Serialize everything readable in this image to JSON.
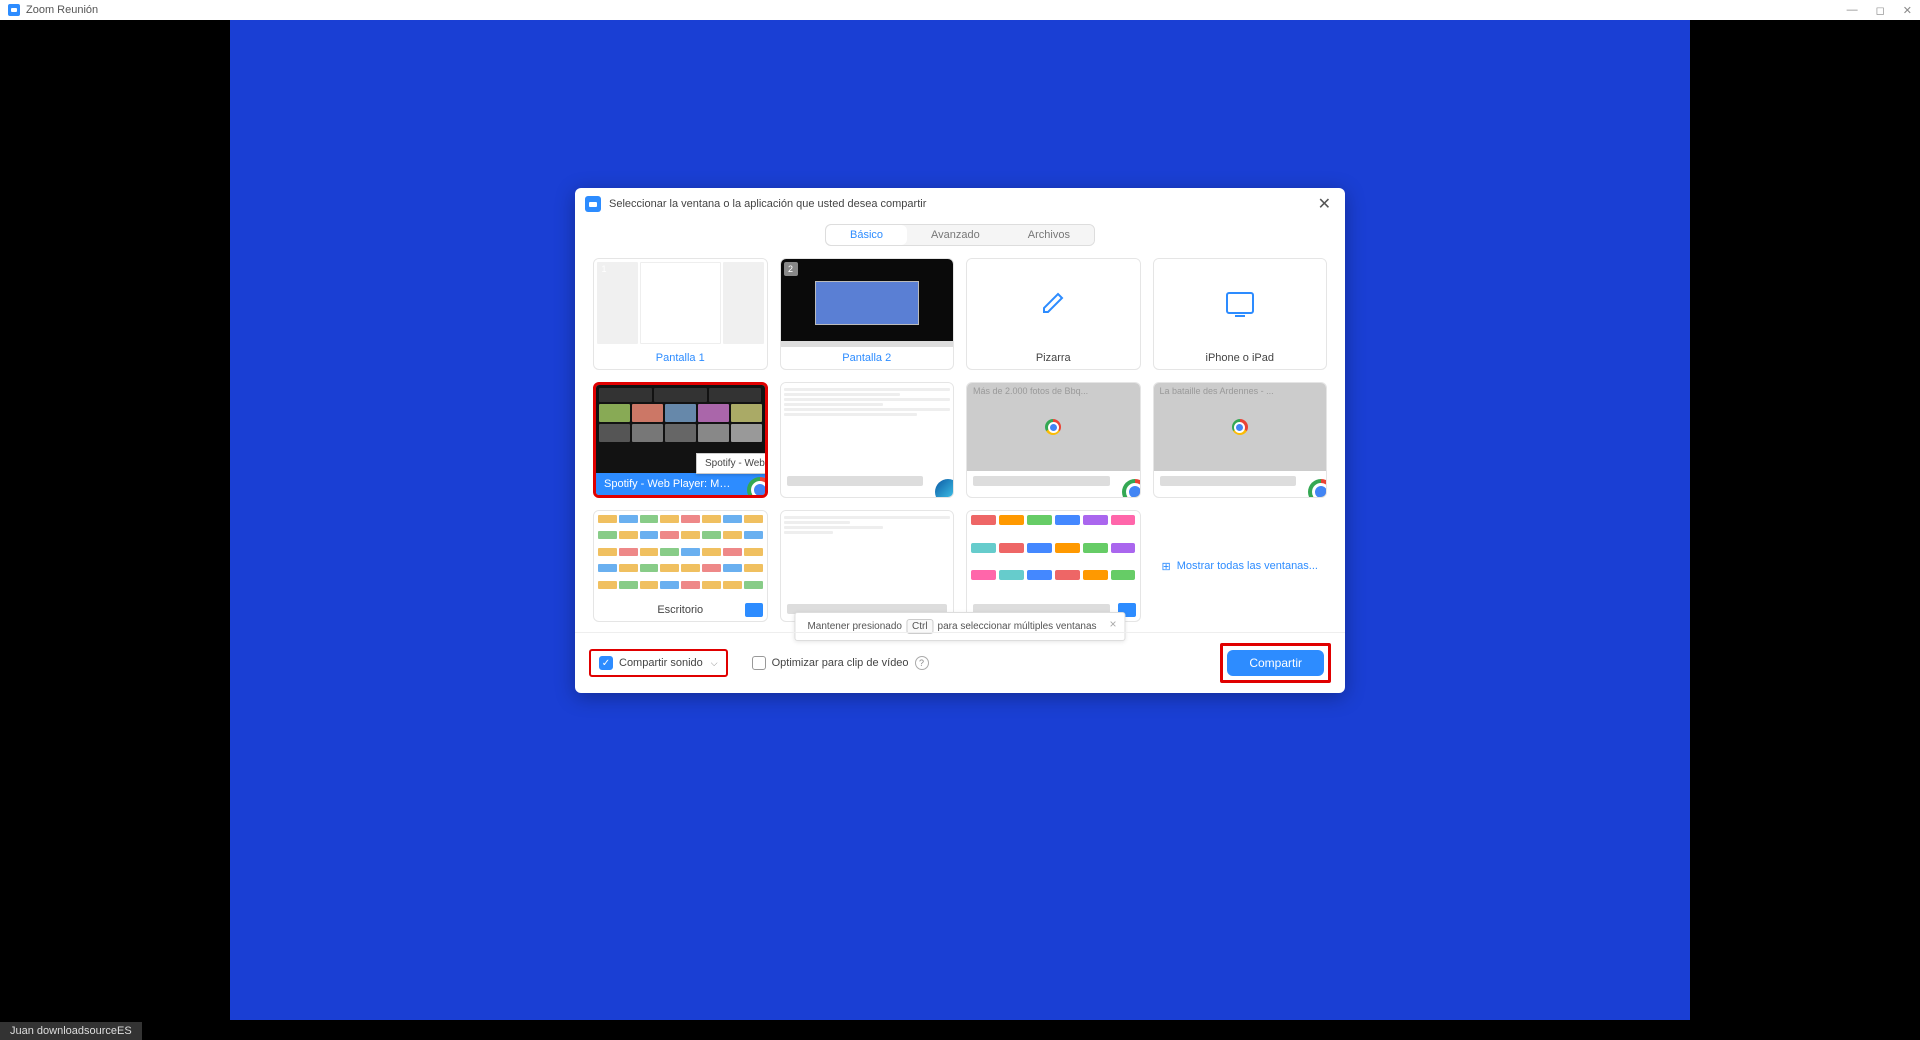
{
  "titlebar": {
    "app_title": "Zoom Reunión"
  },
  "dialog": {
    "header_title": "Seleccionar la ventana o la aplicación que usted desea compartir",
    "tabs": {
      "basic": "Básico",
      "advanced": "Avanzado",
      "files": "Archivos"
    },
    "tiles": {
      "screen1": {
        "label": "Pantalla 1",
        "badge": "1"
      },
      "screen2": {
        "label": "Pantalla 2",
        "badge": "2"
      },
      "whiteboard": {
        "label": "Pizarra"
      },
      "iphone": {
        "label": "iPhone o iPad"
      },
      "spotify": {
        "label": "Spotify - Web Player: Music for e..."
      },
      "edge_window": {
        "label": ""
      },
      "bbq": {
        "label": "",
        "title_overlay": "Más de 2.000 fotos de Bbq..."
      },
      "ardennes": {
        "label": "",
        "title_overlay": "La bataille des Ardennes - ..."
      },
      "desktop": {
        "label": "Escritorio"
      },
      "folder1": {
        "label": ""
      },
      "folder2": {
        "label": ""
      }
    },
    "tooltip": "Spotify - Web Player: Music for everyone - Google Chrome",
    "show_all": "Mostrar todas las ventanas...",
    "hint": {
      "pre": "Mantener presionado",
      "key": "Ctrl",
      "post": "para seleccionar múltiples ventanas"
    },
    "footer": {
      "share_sound": "Compartir sonido",
      "optimize_video": "Optimizar para clip de vídeo",
      "share_button": "Compartir"
    }
  },
  "watermark": "Juan downloadsourceES"
}
